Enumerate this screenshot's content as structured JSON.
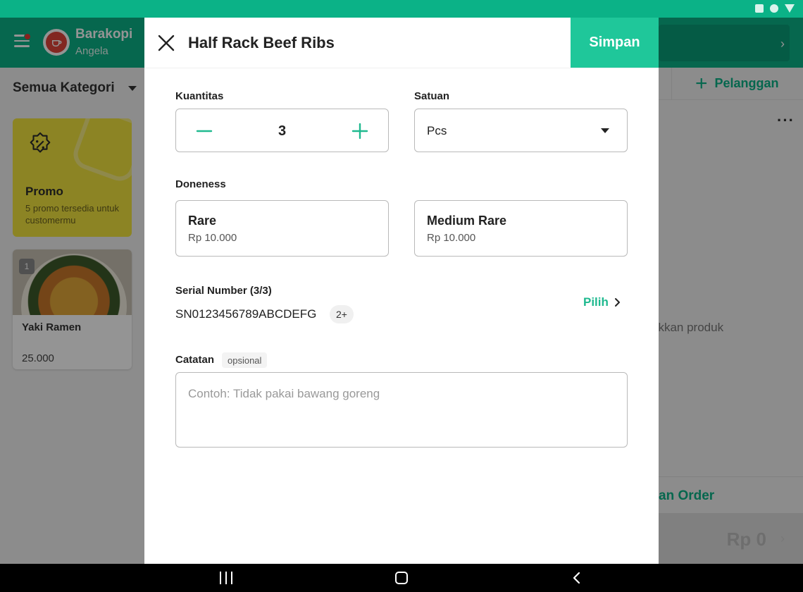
{
  "background": {
    "store_name": "Barakopi",
    "store_user": "Angela",
    "category_label": "Semua Kategori",
    "promo": {
      "title": "Promo",
      "subtitle": "5 promo tersedia untuk customermu"
    },
    "product": {
      "name": "Yaki Ramen",
      "price": "25.000",
      "qty_badge": "1"
    },
    "add_customer_label": "Pelanggan",
    "empty_text": "ukkan produk",
    "order_label": "an Order",
    "total": "Rp 0"
  },
  "dialog": {
    "title": "Half Rack Beef Ribs",
    "save_label": "Simpan",
    "quantity": {
      "label": "Kuantitas",
      "value": "3"
    },
    "unit": {
      "label": "Satuan",
      "value": "Pcs"
    },
    "doneness": {
      "label": "Doneness",
      "options": [
        {
          "name": "Rare",
          "price": "Rp 10.000"
        },
        {
          "name": "Medium Rare",
          "price": "Rp 10.000"
        }
      ]
    },
    "serial": {
      "label": "Serial Number (3/3)",
      "value": "SN0123456789ABCDEFG",
      "more_badge": "2+",
      "pick_label": "Pilih"
    },
    "notes": {
      "label": "Catatan",
      "optional_chip": "opsional",
      "placeholder": "Contoh: Tidak pakai bawang goreng"
    }
  },
  "colors": {
    "brand_green": "#0bb287",
    "accent_green": "#1fc79a",
    "promo_yellow": "#f1e33f"
  },
  "icons": [
    "menu-icon",
    "close-icon",
    "minus-icon",
    "plus-icon",
    "caret-down-icon",
    "chevron-right-icon",
    "discount-icon",
    "more-icon"
  ]
}
